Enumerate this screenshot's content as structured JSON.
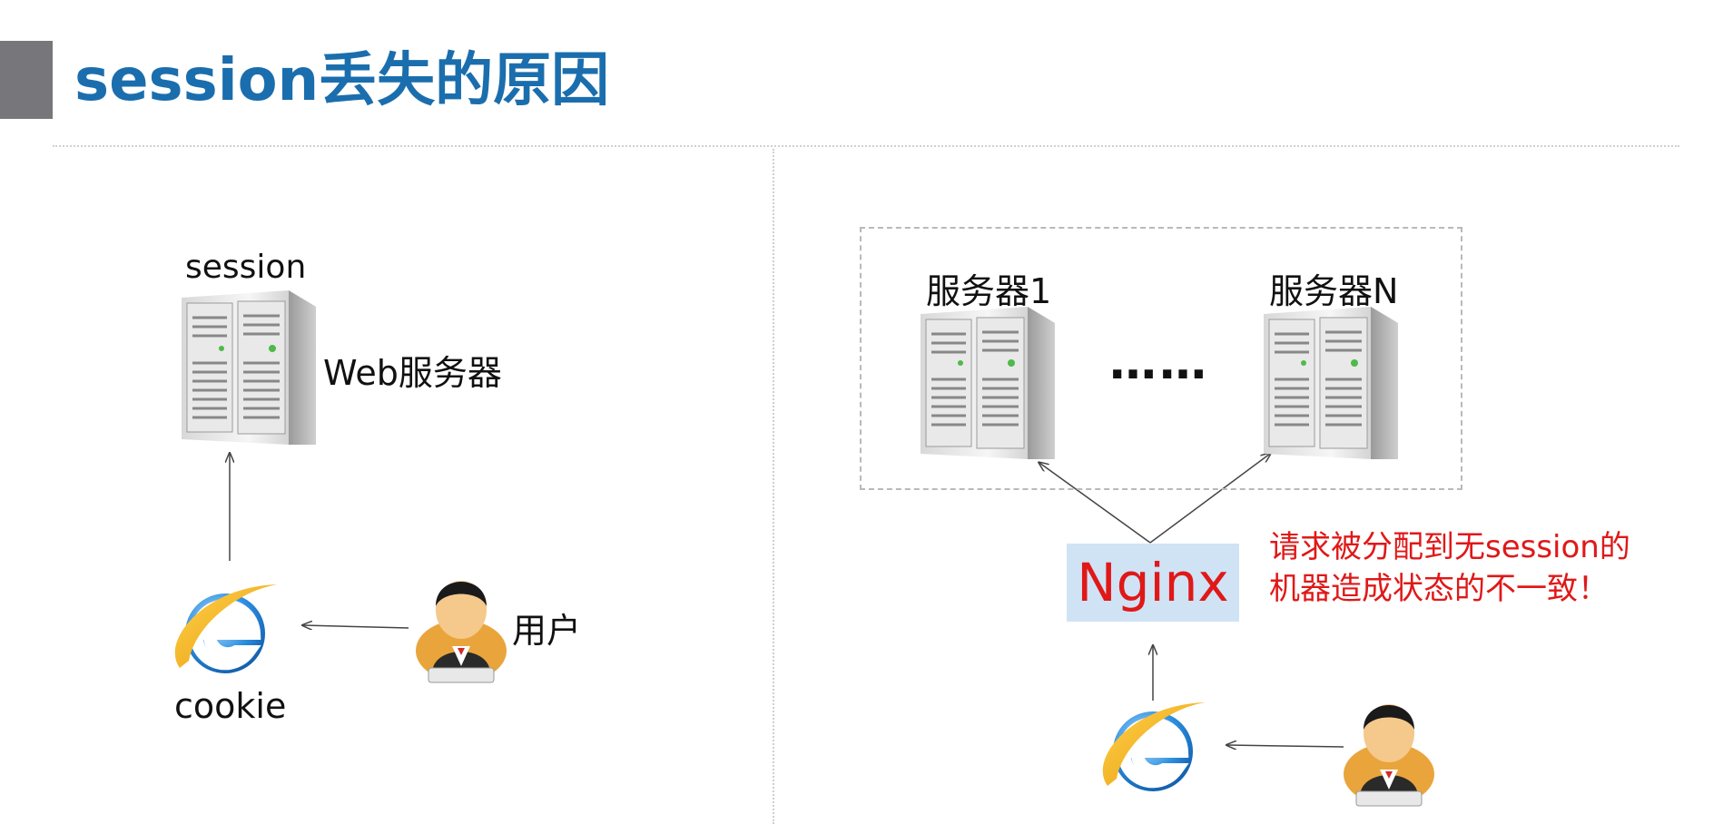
{
  "title": "session丢失的原因",
  "left": {
    "session_label": "session",
    "server_label": "Web服务器",
    "cookie_label": "cookie",
    "user_label": "用户"
  },
  "right": {
    "server1_label": "服务器1",
    "serverN_label": "服务器N",
    "ellipsis": "……",
    "nginx_label": "Nginx",
    "note_line1": "请求被分配到无session的",
    "note_line2": "机器造成状态的不一致！"
  }
}
